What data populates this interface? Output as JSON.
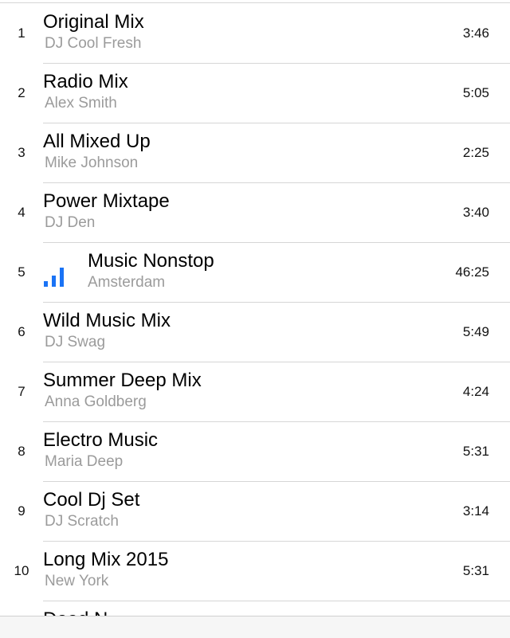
{
  "tracks": [
    {
      "number": "1",
      "title": "Original Mix",
      "artist": "DJ Cool Fresh",
      "duration": "3:46",
      "playing": false
    },
    {
      "number": "2",
      "title": "Radio Mix",
      "artist": "Alex Smith",
      "duration": "5:05",
      "playing": false
    },
    {
      "number": "3",
      "title": "All Mixed Up",
      "artist": "Mike Johnson",
      "duration": "2:25",
      "playing": false
    },
    {
      "number": "4",
      "title": "Power Mixtape",
      "artist": "DJ Den",
      "duration": "3:40",
      "playing": false
    },
    {
      "number": "5",
      "title": "Music Nonstop",
      "artist": "Amsterdam",
      "duration": "46:25",
      "playing": true
    },
    {
      "number": "6",
      "title": "Wild Music Mix",
      "artist": "DJ Swag",
      "duration": "5:49",
      "playing": false
    },
    {
      "number": "7",
      "title": "Summer Deep Mix",
      "artist": "Anna Goldberg",
      "duration": "4:24",
      "playing": false
    },
    {
      "number": "8",
      "title": "Electro Music",
      "artist": "Maria Deep",
      "duration": "5:31",
      "playing": false
    },
    {
      "number": "9",
      "title": "Cool Dj Set",
      "artist": "DJ Scratch",
      "duration": "3:14",
      "playing": false
    },
    {
      "number": "10",
      "title": "Long Mix 2015",
      "artist": "New York",
      "duration": "5:31",
      "playing": false
    }
  ],
  "partial_track": {
    "title": "Dead N"
  },
  "colors": {
    "accent": "#1a73f5",
    "secondary_text": "#9b9b9b",
    "separator": "#d6d6d6"
  },
  "icons": {
    "now_playing": "equalizer-bars-icon"
  }
}
